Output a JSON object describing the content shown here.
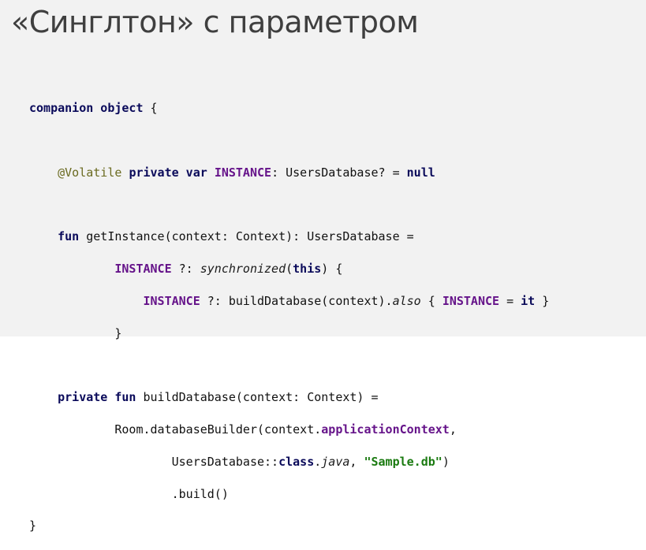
{
  "slide": {
    "title": "«Синглтон» с параметром"
  },
  "code": {
    "l1_kw": "companion object",
    "l1_rest": " {",
    "l3_indent": "    ",
    "l3_anno": "@Volatile",
    "l3_sp": " ",
    "l3_kw": "private var",
    "l3_sp2": " ",
    "l3_inst": "INSTANCE",
    "l3_rest": ": UsersDatabase? = ",
    "l3_null": "null",
    "l5_indent": "    ",
    "l5_kw": "fun",
    "l5_rest": " getInstance(context: Context): UsersDatabase =",
    "l6_indent": "            ",
    "l6_inst": "INSTANCE",
    "l6_op": " ?: ",
    "l6_sync": "synchronized",
    "l6_p1": "(",
    "l6_this": "this",
    "l6_p2": ") {",
    "l7_indent": "                ",
    "l7_inst": "INSTANCE",
    "l7_mid": " ?: buildDatabase(context).",
    "l7_also": "also",
    "l7_brace": " { ",
    "l7_inst2": "INSTANCE",
    "l7_eq": " = ",
    "l7_it": "it",
    "l7_end": " }",
    "l8_indent": "            ",
    "l8_brace": "}",
    "l10_indent": "    ",
    "l10_kw": "private fun",
    "l10_rest": " buildDatabase(context: Context) =",
    "l11_indent": "            ",
    "l11_pre": "Room.databaseBuilder(context.",
    "l11_app": "applicationContext",
    "l11_end": ",",
    "l12_indent": "                    ",
    "l12_pre": "UsersDatabase::",
    "l12_class": "class",
    "l12_dot": ".",
    "l12_java": "java",
    "l12_comma": ", ",
    "l12_str": "\"Sample.db\"",
    "l12_end": ")",
    "l13_indent": "                    ",
    "l13_build": ".build()",
    "l14_brace": "}"
  }
}
